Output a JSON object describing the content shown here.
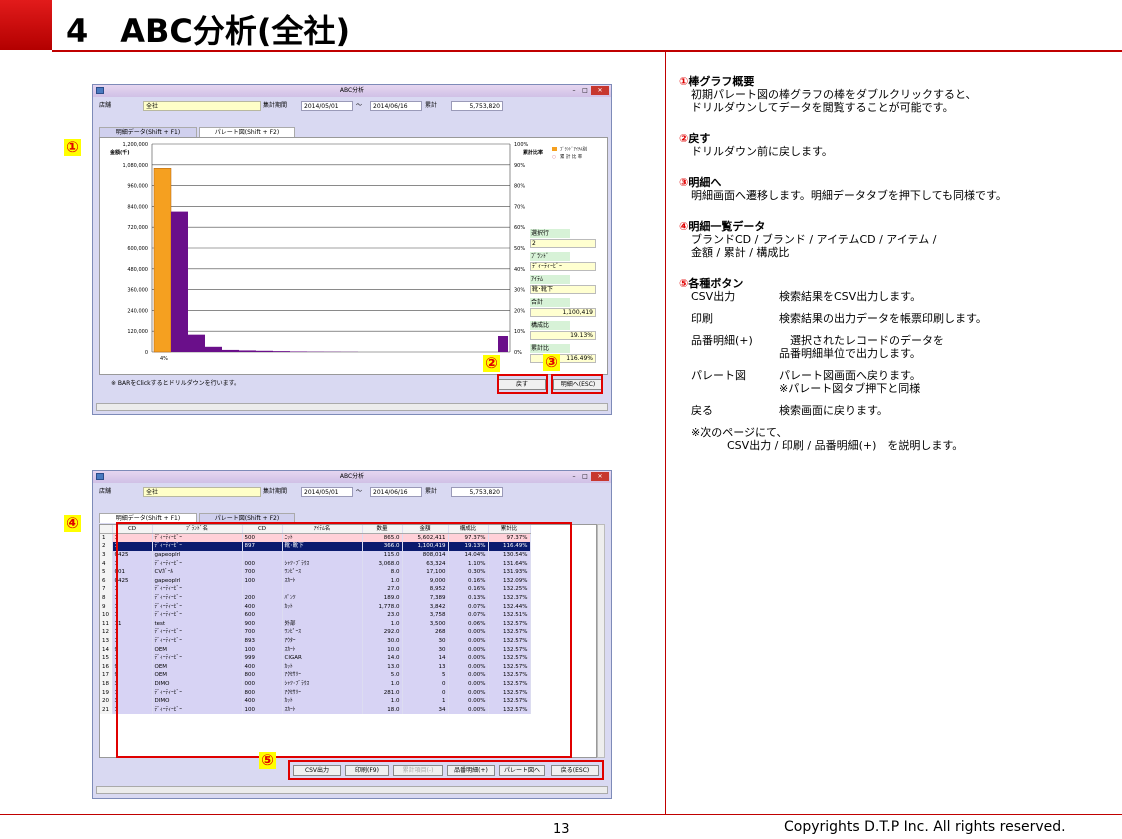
{
  "header": {
    "title": "4　ABC分析(全社)"
  },
  "footer": {
    "page": "13",
    "copyright": "Copyrights  D.T.P Inc. All rights reserved."
  },
  "markers": {
    "m1": "①",
    "m2": "②",
    "m3": "③",
    "m4": "④",
    "m5": "⑤"
  },
  "win1": {
    "title": "ABC分析",
    "store_label": "店舗",
    "store_value": "全社",
    "period_label": "集計期間",
    "period_from": "2014/05/01",
    "tilde": "～",
    "period_to": "2014/06/16",
    "total_label": "累計",
    "total_value": "5,753,820",
    "tab_detail": "明細データ(Shift + F1)",
    "tab_pareto": "パレート図(Shift + F2)",
    "hint": "※ BARをClickするとドリルダウンを行います。",
    "btn_back": "戻す",
    "btn_detail": "明細へ(ESC)",
    "side": {
      "selected_row_label": "選択行",
      "selected_row": "2",
      "brand_label": "ﾌﾞﾗﾝﾄﾞ",
      "brand": "ﾃﾞｨｰﾃｨｰﾋﾞｰ",
      "item_label": "ｱｲﾃﾑ",
      "item": "靴･靴下",
      "total_label": "合計",
      "total": "1,100,419",
      "ratio_label": "構成比",
      "ratio": "19.13%",
      "cum_label": "累計比",
      "cum": "116.49%"
    }
  },
  "chart_data": {
    "type": "bar",
    "ylabel": "金額(千)",
    "y2label": "累計比率",
    "ylim": [
      0,
      1200000
    ],
    "y2lim": [
      0,
      100
    ],
    "yticks": [
      "1,200,000",
      "1,080,000",
      "960,000",
      "840,000",
      "720,000",
      "600,000",
      "480,000",
      "360,000",
      "240,000",
      "120,000",
      "0"
    ],
    "y2ticks": [
      "100%",
      "90%",
      "80%",
      "70%",
      "60%",
      "50%",
      "40%",
      "30%",
      "20%",
      "10%",
      "0%"
    ],
    "x_label_first": "4%",
    "legend": [
      "ﾌﾞﾗﾝﾄﾞｱｲﾃﾑ別",
      "累 計 比 率"
    ],
    "values": [
      1060000,
      810000,
      100000,
      30000,
      12000,
      9000,
      7000,
      5000,
      3000,
      2000,
      1500,
      1000
    ],
    "colors": [
      "#f5a020",
      "#6a0f8a"
    ]
  },
  "win2": {
    "title": "ABC分析",
    "store_label": "店舗",
    "store_value": "全社",
    "period_label": "集計期間",
    "period_from": "2014/05/01",
    "tilde": "～",
    "period_to": "2014/06/16",
    "total_label": "累計",
    "total_value": "5,753,820",
    "tab_detail": "明細データ(Shift + F1)",
    "tab_pareto": "パレート図(Shift + F2)",
    "columns": [
      "CD",
      "ﾌﾞﾗﾝﾄﾞ名",
      "CD",
      "ｱｲﾃﾑ名",
      "数量",
      "金額",
      "構成比",
      "累計比"
    ],
    "rows": [
      [
        "1",
        "1",
        "ﾃﾞｨｰﾃｨｰﾋﾞｰ",
        "500",
        "ﾆｯﾄ",
        "865.0",
        "5,602,411",
        "97.37%",
        "97.37%"
      ],
      [
        "2",
        "1",
        "ﾃﾞｨｰﾃｨｰﾋﾞｰ",
        "897",
        "靴･靴下",
        "366.0",
        "1,100,419",
        "19.13%",
        "116.49%"
      ],
      [
        "3",
        "0425",
        "gapeoplrl",
        "",
        "",
        "115.0",
        "808,014",
        "14.04%",
        "130.54%"
      ],
      [
        "4",
        "1",
        "ﾃﾞｨｰﾃｨｰﾋﾞｰ",
        "000",
        "ｼｬﾂ･ﾌﾞﾗｳｽ",
        "3,068.0",
        "63,324",
        "1.10%",
        "131.64%"
      ],
      [
        "5",
        "001",
        "CVｶﾞｰﾙ",
        "700",
        "ﾜﾝﾋﾟｰｽ",
        "8.0",
        "17,100",
        "0.30%",
        "131.93%"
      ],
      [
        "6",
        "0425",
        "gapeoplrl",
        "100",
        "ｽｶｰﾄ",
        "1.0",
        "9,000",
        "0.16%",
        "132.09%"
      ],
      [
        "7",
        "1",
        "ﾃﾞｨｰﾃｨｰﾋﾞｰ",
        "",
        "",
        "27.0",
        "8,952",
        "0.16%",
        "132.25%"
      ],
      [
        "8",
        "1",
        "ﾃﾞｨｰﾃｨｰﾋﾞｰ",
        "200",
        "ﾊﾟﾝﾂ",
        "189.0",
        "7,389",
        "0.13%",
        "132.37%"
      ],
      [
        "9",
        "1",
        "ﾃﾞｨｰﾃｨｰﾋﾞｰ",
        "400",
        "ｶｯﾄ",
        "1,778.0",
        "3,842",
        "0.07%",
        "132.44%"
      ],
      [
        "10",
        "1",
        "ﾃﾞｨｰﾃｨｰﾋﾞｰ",
        "600",
        "",
        "23.0",
        "3,758",
        "0.07%",
        "132.51%"
      ],
      [
        "11",
        "11",
        "test",
        "900",
        "外部",
        "1.0",
        "3,500",
        "0.06%",
        "132.57%"
      ],
      [
        "12",
        "1",
        "ﾃﾞｨｰﾃｨｰﾋﾞｰ",
        "700",
        "ﾜﾝﾋﾟｰｽ",
        "292.0",
        "268",
        "0.00%",
        "132.57%"
      ],
      [
        "13",
        "1",
        "ﾃﾞｨｰﾃｨｰﾋﾞｰ",
        "893",
        "ｱｳﾀｰ",
        "30.0",
        "30",
        "0.00%",
        "132.57%"
      ],
      [
        "14",
        "9",
        "OEM",
        "100",
        "ｽｶｰﾄ",
        "10.0",
        "30",
        "0.00%",
        "132.57%"
      ],
      [
        "15",
        "1",
        "ﾃﾞｨｰﾃｨｰﾋﾞｰ",
        "999",
        "CIGAR",
        "14.0",
        "14",
        "0.00%",
        "132.57%"
      ],
      [
        "16",
        "9",
        "OEM",
        "400",
        "ｶｯﾄ",
        "13.0",
        "13",
        "0.00%",
        "132.57%"
      ],
      [
        "17",
        "9",
        "OEM",
        "800",
        "ｱｸｾｻﾘｰ",
        "5.0",
        "5",
        "0.00%",
        "132.57%"
      ],
      [
        "18",
        "3",
        "DIMO",
        "000",
        "ｼｬﾂ･ﾌﾞﾗｳｽ",
        "1.0",
        "0",
        "0.00%",
        "132.57%"
      ],
      [
        "19",
        "1",
        "ﾃﾞｨｰﾃｨｰﾋﾞｰ",
        "800",
        "ｱｸｾｻﾘｰ",
        "281.0",
        "0",
        "0.00%",
        "132.57%"
      ],
      [
        "20",
        "3",
        "DIMO",
        "400",
        "ｶｯﾄ",
        "1.0",
        "1",
        "0.00%",
        "132.57%"
      ],
      [
        "21",
        "1",
        "ﾃﾞｨｰﾃｨｰﾋﾞｰ",
        "100",
        "ｽｶｰﾄ",
        "18.0",
        "34",
        "0.00%",
        "132.57%"
      ]
    ],
    "buttons": [
      "CSV出力",
      "印刷(F9)",
      "累計項目(-)",
      "品番明細(+)",
      "パレート図へ",
      "戻る(ESC)"
    ]
  },
  "notes": [
    {
      "num": "①",
      "title": "棒グラフ概要",
      "lines": [
        "初期パレート図の棒グラフの棒をダブルクリックすると、",
        "ドリルダウンしてデータを閲覧することが可能です。"
      ]
    },
    {
      "num": "②",
      "title": "戻す",
      "lines": [
        "ドリルダウン前に戻します。"
      ]
    },
    {
      "num": "③",
      "title": "明細へ",
      "lines": [
        "明細画面へ遷移します。明細データタブを押下しても同様です。"
      ]
    },
    {
      "num": "④",
      "title": "明細一覧データ",
      "lines": [
        "ブランドCD / ブランド / アイテムCD / アイテム /",
        "金額 / 累計 / 構成比"
      ]
    }
  ],
  "note5": {
    "num": "⑤",
    "title": "各種ボタン",
    "items": [
      {
        "k": "CSV出力",
        "v": [
          "検索結果をCSV出力します。"
        ]
      },
      {
        "k": "印刷",
        "v": [
          "検索結果の出力データを帳票印刷します。"
        ]
      },
      {
        "k": "品番明細(+)",
        "v": [
          "　選択されたレコードのデータを",
          "品番明細単位で出力します。"
        ]
      },
      {
        "k": "パレート図",
        "v": [
          "パレート図画面へ戻ります。",
          "※パレート図タブ押下と同様"
        ]
      },
      {
        "k": "戻る",
        "v": [
          "検索画面に戻ります。"
        ]
      }
    ],
    "footnote1": "※次のページにて、",
    "footnote2": "CSV出力 / 印刷 / 品番明細(+)　を説明します。"
  }
}
